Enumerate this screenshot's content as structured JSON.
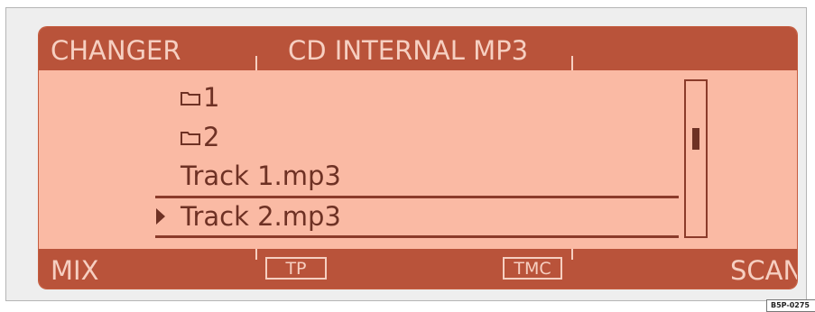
{
  "header": {
    "left_label": "CHANGER",
    "source_label": "CD INTERNAL MP3"
  },
  "list": {
    "items": [
      {
        "label": "1",
        "type": "folder",
        "icon": "folder-icon"
      },
      {
        "label": "2",
        "type": "folder",
        "icon": "folder-icon"
      },
      {
        "label": "Track 1.mp3",
        "type": "file"
      },
      {
        "label": "Track 2.mp3",
        "type": "file",
        "selected": true,
        "marker_icon": "play-arrow-icon"
      }
    ]
  },
  "footer": {
    "mix_label": "MIX",
    "tp_label": "TP",
    "tmc_label": "TMC",
    "scan_label": "SCAN"
  },
  "figure_code": "B5P-0275",
  "colors": {
    "bar": "#b9533a",
    "screen": "#fabaa4",
    "text_dark": "#6e3124",
    "text_light": "#f6cfc1"
  }
}
